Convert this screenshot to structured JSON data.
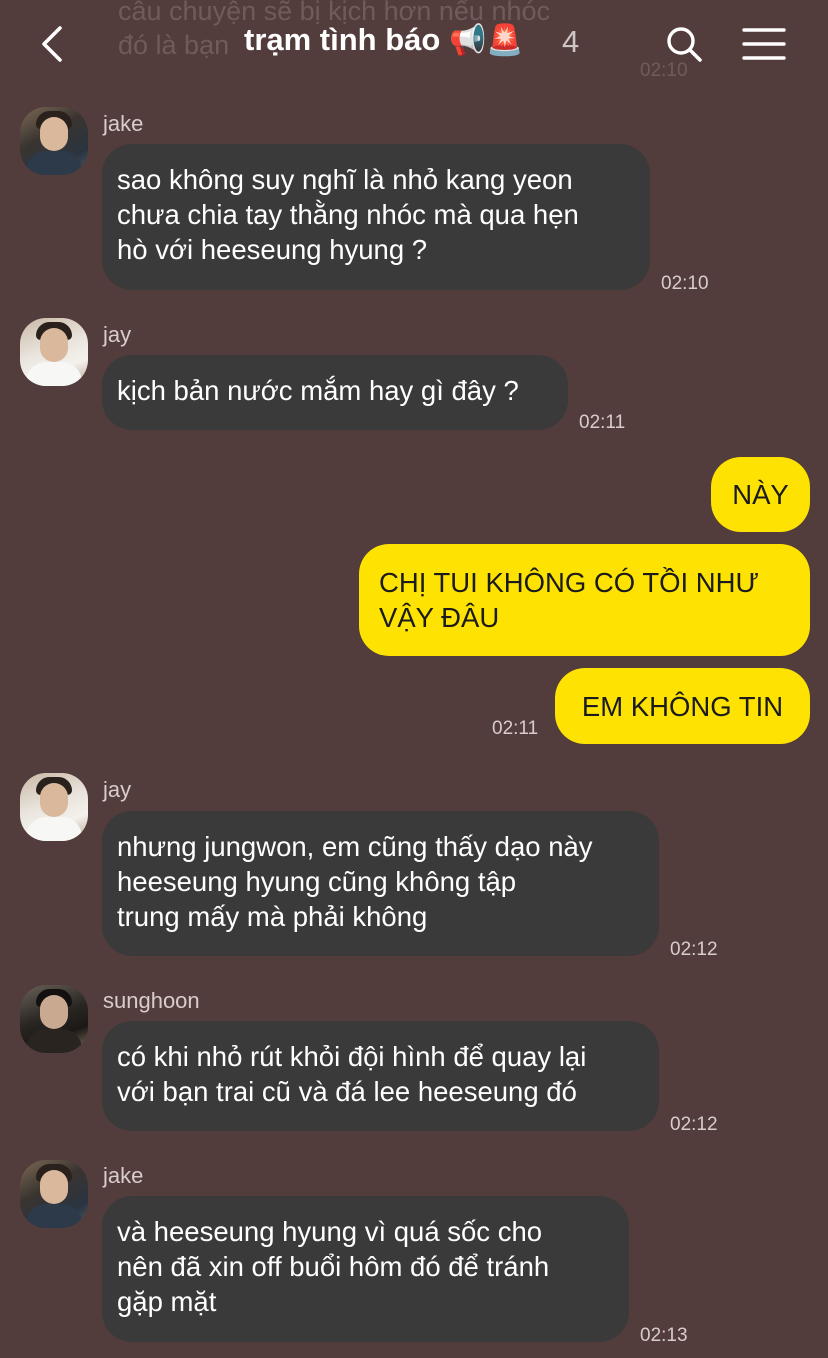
{
  "header": {
    "title": "trạm tình báo",
    "title_emoji": "📢🚨",
    "member_count": "4"
  },
  "faded_previous": {
    "line1": "câu chuyện sẽ bị kịch hơn nếu nhóc",
    "line2": "đó là bạn",
    "time": "02:10"
  },
  "messages": [
    {
      "sender": "jake",
      "lines": [
        "sao không suy nghĩ là nhỏ kang yeon",
        "chưa chia tay thằng nhóc mà qua hẹn",
        "hò với heeseung hyung ?"
      ],
      "time": "02:10"
    },
    {
      "sender": "jay",
      "lines": [
        "kịch bản nước mắm hay gì đây ?"
      ],
      "time": "02:11"
    },
    {
      "sender": "me",
      "lines": [
        "NÀY"
      ]
    },
    {
      "sender": "me",
      "lines": [
        "CHỊ TUI KHÔNG CÓ TỒI NHƯ",
        "VẬY ĐÂU"
      ]
    },
    {
      "sender": "me",
      "lines": [
        "EM KHÔNG TIN"
      ],
      "time": "02:11"
    },
    {
      "sender": "jay",
      "lines": [
        "nhưng jungwon, em cũng thấy dạo này",
        "heeseung hyung cũng không tập",
        "trung mấy mà phải không"
      ],
      "time": "02:12"
    },
    {
      "sender": "sunghoon",
      "lines": [
        "có khi nhỏ rút khỏi đội hình để quay lại",
        "với bạn trai cũ và đá lee heeseung đó"
      ],
      "time": "02:12"
    },
    {
      "sender": "jake",
      "lines": [
        "và heeseung hyung vì quá sốc cho",
        "nên đã xin off buổi hôm đó để tránh",
        "gặp mặt"
      ],
      "time": "02:13"
    }
  ],
  "colors": {
    "background": "#533c3c",
    "incoming_bubble": "#3a3a3b",
    "outgoing_bubble": "#fde202"
  },
  "icons": [
    "back-icon",
    "search-icon",
    "menu-icon"
  ]
}
